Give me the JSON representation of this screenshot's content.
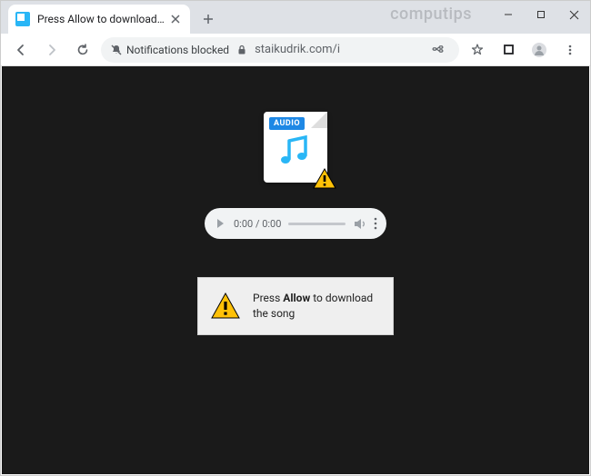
{
  "watermark": "computips",
  "tab": {
    "title": "Press Allow to download the son"
  },
  "toolbar": {
    "notifications_blocked": "Notifications blocked",
    "url": "staikudrik.com/i"
  },
  "audio_badge": "AUDIO",
  "player": {
    "time": "0:00 / 0:00"
  },
  "message": {
    "pre": "Press ",
    "bold": "Allow",
    "post": " to download the song"
  }
}
